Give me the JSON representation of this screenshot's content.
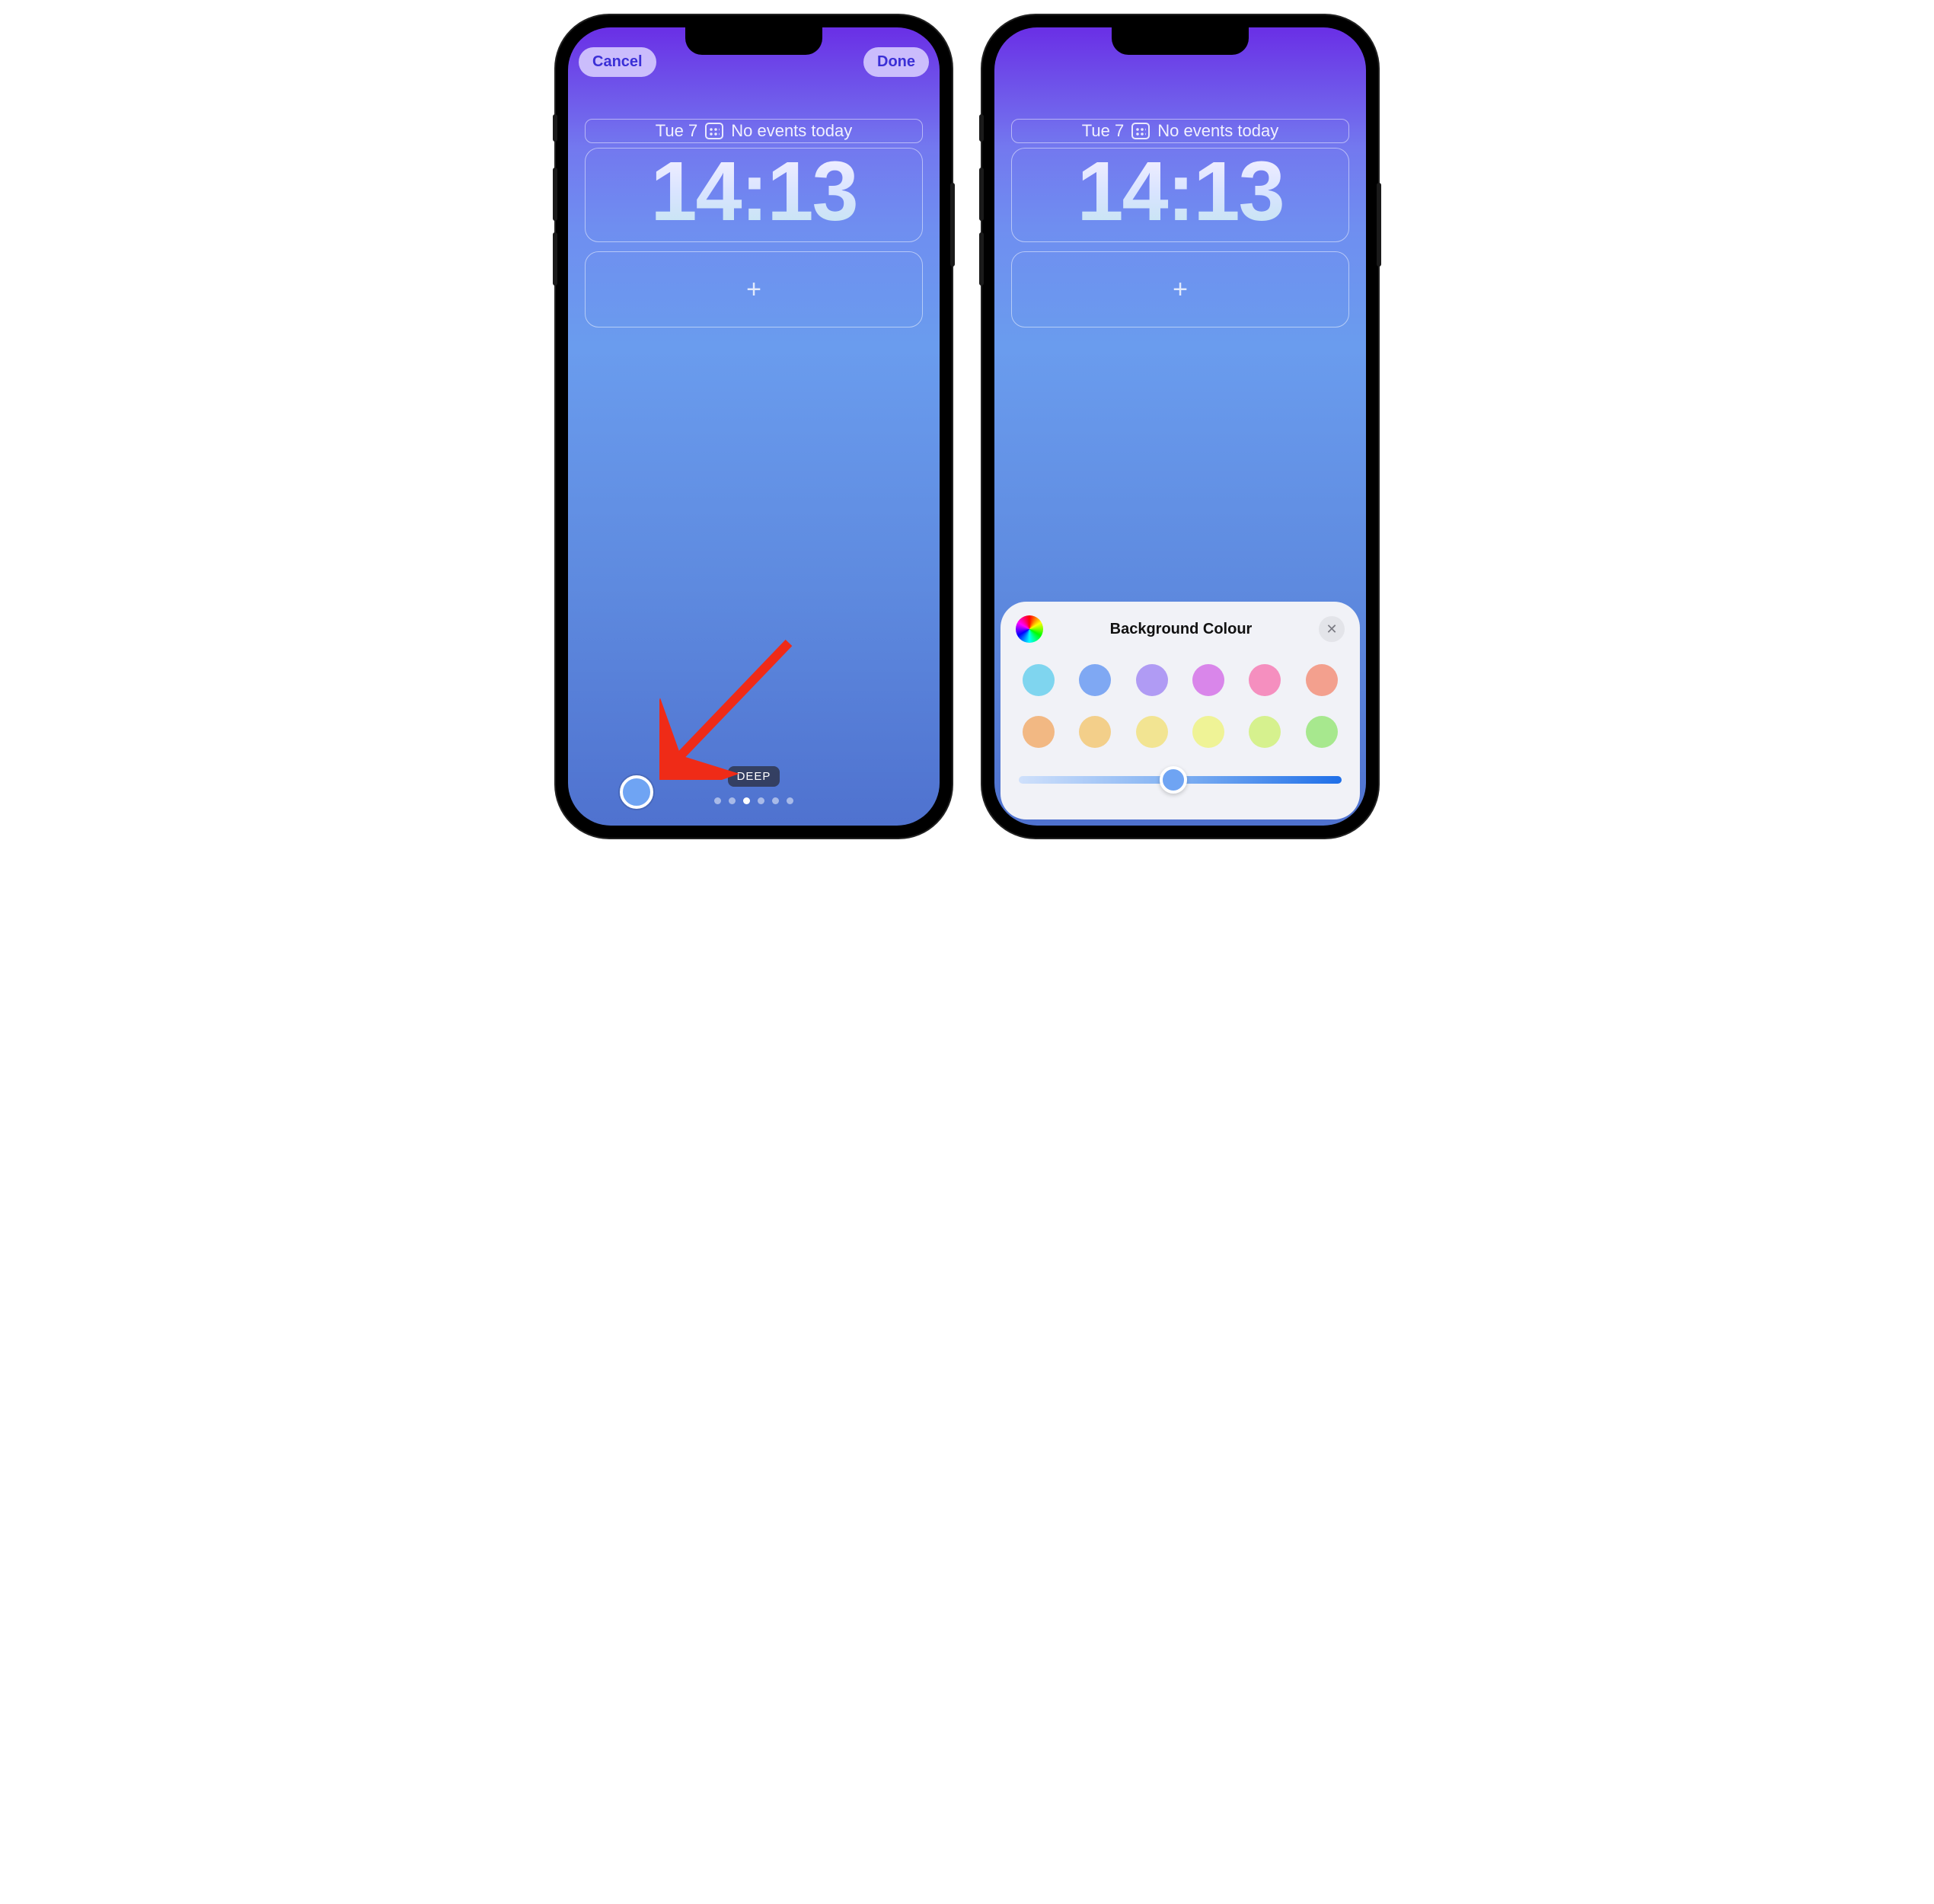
{
  "left": {
    "cancel": "Cancel",
    "done": "Done",
    "date": "Tue 7",
    "events": "No events today",
    "time": "14:13",
    "add_widget_glyph": "+",
    "tag": "DEEP",
    "page_dots": {
      "count": 6,
      "active_index": 2
    },
    "color_button": "#6fa4f3"
  },
  "right": {
    "date": "Tue 7",
    "events": "No events today",
    "time": "14:13",
    "add_widget_glyph": "+",
    "panel": {
      "title": "Background Colour",
      "close_glyph": "✕",
      "swatches": [
        "#7fd5ef",
        "#7fa8f3",
        "#b09bf4",
        "#d986ea",
        "#f58fbf",
        "#f3a08e",
        "#f2b883",
        "#f3cf8a",
        "#f2e492",
        "#eff396",
        "#d6f18e",
        "#a7e88e"
      ],
      "slider": {
        "percent": 48,
        "gradient_from": "#cfe0fb",
        "gradient_mid": "#7fb0f2",
        "gradient_to": "#1f6fe8",
        "thumb_color": "#6fa4f3"
      }
    }
  }
}
